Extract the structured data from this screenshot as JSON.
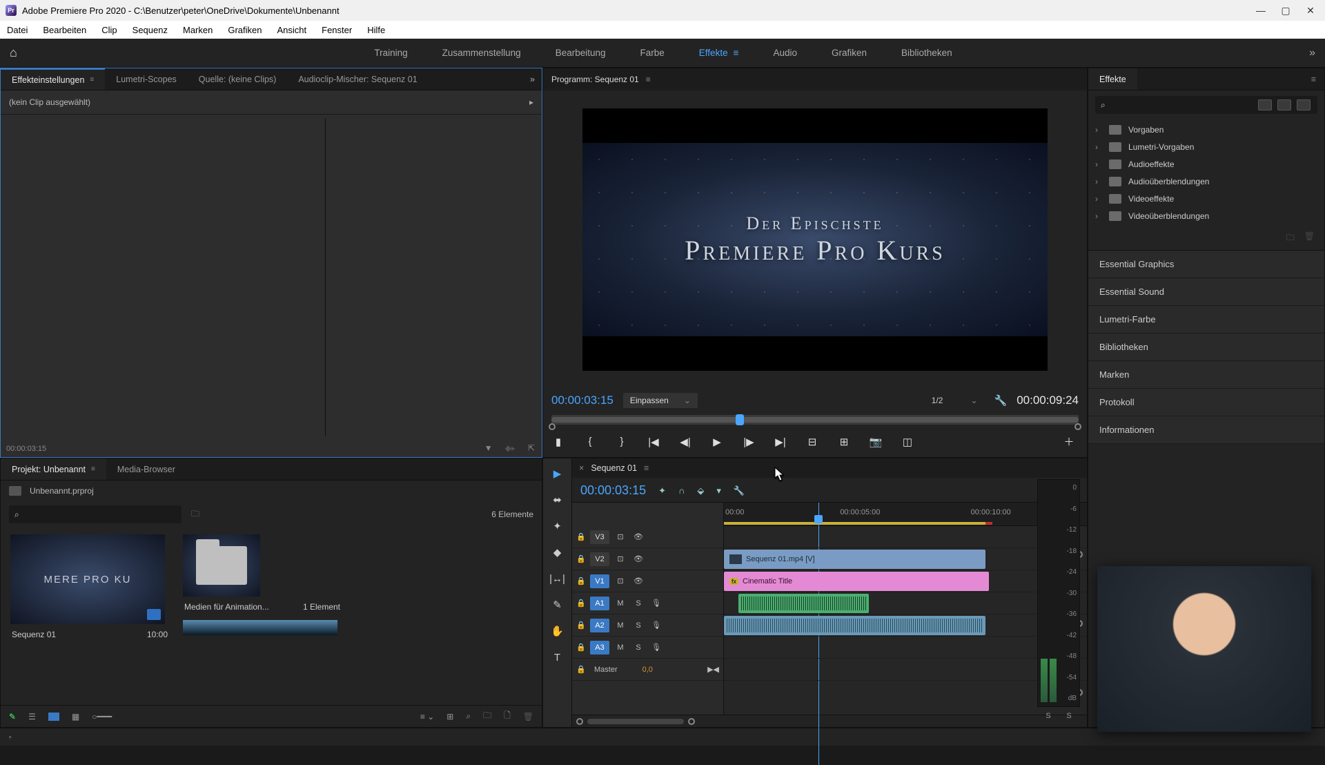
{
  "titlebar": {
    "app_name": "Pr",
    "title": "Adobe Premiere Pro 2020 - C:\\Benutzer\\peter\\OneDrive\\Dokumente\\Unbenannt"
  },
  "menubar": [
    "Datei",
    "Bearbeiten",
    "Clip",
    "Sequenz",
    "Marken",
    "Grafiken",
    "Ansicht",
    "Fenster",
    "Hilfe"
  ],
  "workspaces": [
    "Training",
    "Zusammenstellung",
    "Bearbeitung",
    "Farbe",
    "Effekte",
    "Audio",
    "Grafiken",
    "Bibliotheken"
  ],
  "active_workspace": "Effekte",
  "source_panel": {
    "tabs": [
      "Effekteinstellungen",
      "Lumetri-Scopes",
      "Quelle: (keine Clips)",
      "Audioclip-Mischer: Sequenz 01"
    ],
    "active_tab": 0,
    "no_clip": "(kein Clip ausgewählt)",
    "timecode": "00:00:03:15"
  },
  "program": {
    "title": "Programm: Sequenz 01",
    "viewer_line1": "Der Epischste",
    "viewer_line2": "Premiere Pro Kurs",
    "tc_current": "00:00:03:15",
    "fit": "Einpassen",
    "resolution": "1/2",
    "tc_duration": "00:00:09:24"
  },
  "effects_panel": {
    "title": "Effekte",
    "search_placeholder": "",
    "folders": [
      "Vorgaben",
      "Lumetri-Vorgaben",
      "Audioeffekte",
      "Audioüberblendungen",
      "Videoeffekte",
      "Videoüberblendungen"
    ],
    "side_panels": [
      "Essential Graphics",
      "Essential Sound",
      "Lumetri-Farbe",
      "Bibliotheken",
      "Marken",
      "Protokoll",
      "Informationen"
    ]
  },
  "project": {
    "tabs": [
      "Projekt: Unbenannt",
      "Media-Browser"
    ],
    "active_tab": 0,
    "file": "Unbenannt.prproj",
    "count": "6 Elemente",
    "items": [
      {
        "name": "Sequenz 01",
        "meta": "10:00",
        "thumb_text": "MERE PRO KU"
      },
      {
        "name": "Medien für Animation...",
        "meta": "1 Element"
      }
    ]
  },
  "timeline": {
    "seq_name": "Sequenz 01",
    "tc": "00:00:03:15",
    "ruler_ticks": [
      "00:00",
      "00:00:05:00",
      "00:00:10:00"
    ],
    "tracks": {
      "video": [
        {
          "label": "V3",
          "selected": false
        },
        {
          "label": "V2",
          "selected": false
        },
        {
          "label": "V1",
          "selected": true
        }
      ],
      "audio": [
        {
          "label": "A1",
          "selected": true
        },
        {
          "label": "A2",
          "selected": true
        },
        {
          "label": "A3",
          "selected": true
        }
      ],
      "master_label": "Master",
      "master_val": "0,0"
    },
    "clips": {
      "v2": "Sequenz 01.mp4 [V]",
      "v1": "Cinematic Title"
    }
  },
  "meters": {
    "scale": [
      "0",
      "-6",
      "-12",
      "-18",
      "-24",
      "-30",
      "-36",
      "-42",
      "-48",
      "-54",
      "dB"
    ],
    "solo": "S"
  }
}
